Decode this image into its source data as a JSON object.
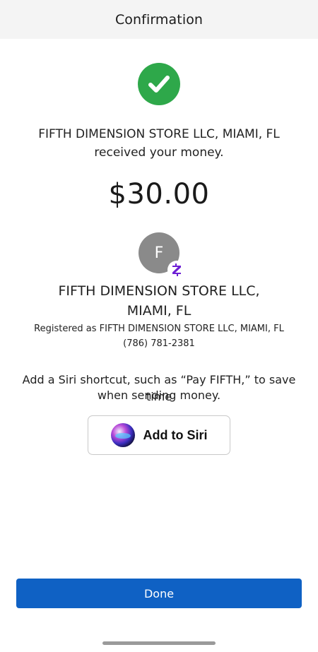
{
  "header": {
    "title": "Confirmation"
  },
  "status": {
    "icon": "check-circle-icon",
    "color": "#2ea84a"
  },
  "message": {
    "line1": "FIFTH DIMENSION STORE LLC, MIAMI, FL",
    "line2": "received your money."
  },
  "amount": "$30.00",
  "recipient": {
    "avatar_initial": "F",
    "badge": "zelle-icon",
    "name_line1": "FIFTH DIMENSION STORE LLC,",
    "name_line2": "MIAMI, FL",
    "registered": "Registered as FIFTH DIMENSION STORE LLC, MIAMI, FL",
    "phone": "(786) 781-2381"
  },
  "siri": {
    "text_line1": "Add a Siri shortcut, such as “Pay FIFTH,” to save time",
    "text_line2": "when sending money.",
    "button_label": "Add to Siri",
    "icon": "siri-icon"
  },
  "footer": {
    "done_label": "Done",
    "button_color": "#0f61c4"
  }
}
